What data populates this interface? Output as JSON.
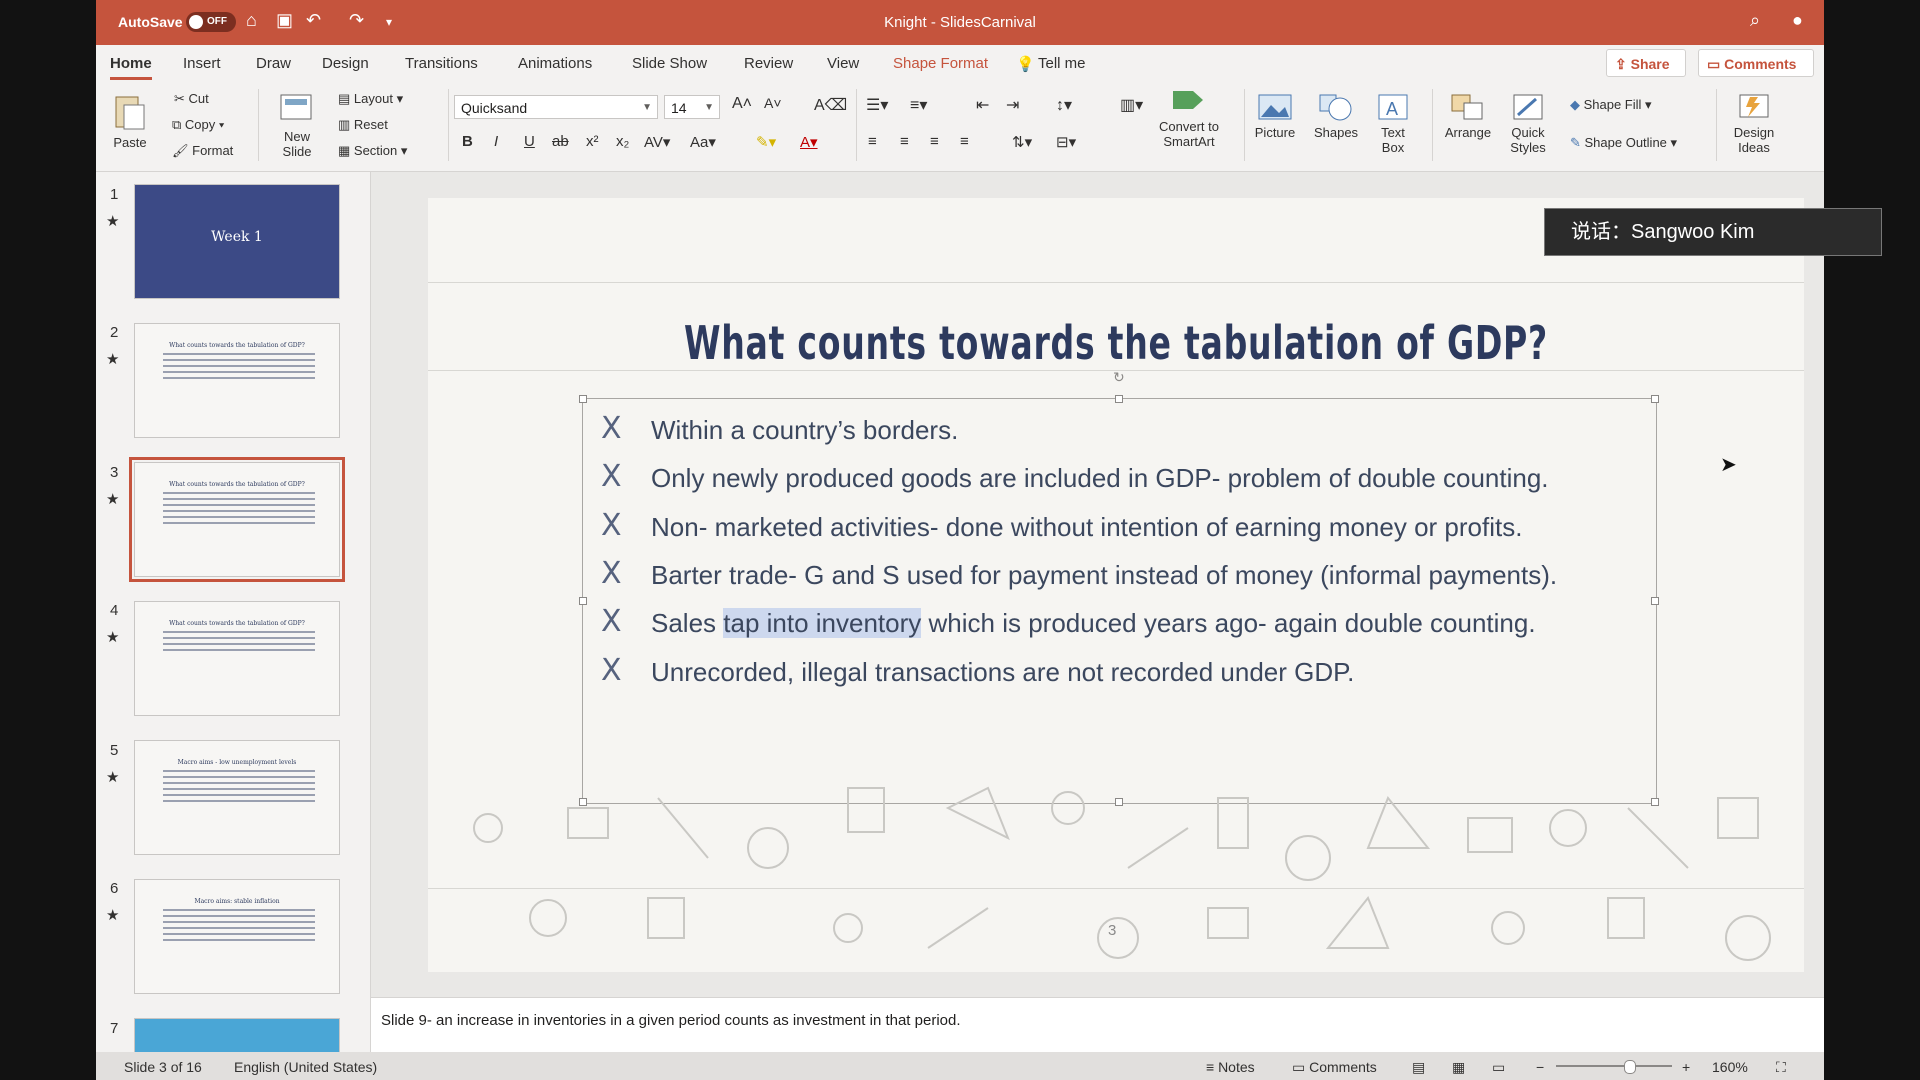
{
  "titlebar": {
    "autosave_label": "AutoSave",
    "autosave_state": "OFF",
    "title": "Knight - SlidesCarnival"
  },
  "tabs": [
    "Home",
    "Insert",
    "Draw",
    "Design",
    "Transitions",
    "Animations",
    "Slide Show",
    "Review",
    "View",
    "Shape Format",
    "Tell me"
  ],
  "share_label": "Share",
  "comments_label": "Comments",
  "ribbon": {
    "paste": "Paste",
    "cut": "Cut",
    "copy": "Copy",
    "format": "Format",
    "new_slide": "New Slide",
    "layout": "Layout",
    "reset": "Reset",
    "section": "Section",
    "font_name": "Quicksand",
    "font_size": "14",
    "convert_smartart": "Convert to SmartArt",
    "picture": "Picture",
    "shapes": "Shapes",
    "text_box": "Text Box",
    "arrange": "Arrange",
    "quick_styles": "Quick Styles",
    "shape_fill": "Shape Fill",
    "shape_outline": "Shape Outline",
    "design_ideas": "Design Ideas"
  },
  "thumbnails": [
    {
      "num": "1",
      "title": "Week 1"
    },
    {
      "num": "2",
      "title": "What counts towards the tabulation of GDP?"
    },
    {
      "num": "3",
      "title": "What counts towards the tabulation of GDP?"
    },
    {
      "num": "4",
      "title": "What counts towards the tabulation of GDP?"
    },
    {
      "num": "5",
      "title": "Macro aims - low unemployment levels"
    },
    {
      "num": "6",
      "title": "Macro aims: stable inflation"
    },
    {
      "num": "7",
      "title": ""
    }
  ],
  "slide": {
    "title": "What counts towards the tabulation of GDP?",
    "bullet_marker": "X",
    "bullets": [
      {
        "text": "Within a country’s borders."
      },
      {
        "text": "Only newly produced goods are included in GDP- problem of double counting."
      },
      {
        "text": "Non- marketed activities- done without intention of earning money or profits."
      },
      {
        "text": "Barter trade- G and S used for payment instead of money (informal payments)."
      },
      {
        "pre": "Sales ",
        "highlight": "tap into inventory",
        "post": " which is produced years ago- again double counting."
      },
      {
        "text": "Unrecorded, illegal transactions are not recorded under GDP."
      }
    ],
    "page_number": "3"
  },
  "notes": "Slide 9- an increase in inventories in a given period counts as investment in that period.",
  "status": {
    "slide_of": "Slide 3 of 16",
    "language": "English (United States)",
    "notes": "Notes",
    "comments": "Comments",
    "zoom": "160%"
  },
  "speaker": "说话：Sangwoo Kim",
  "colors": {
    "accent": "#c5543d",
    "title_navy": "#2d3a5e"
  }
}
